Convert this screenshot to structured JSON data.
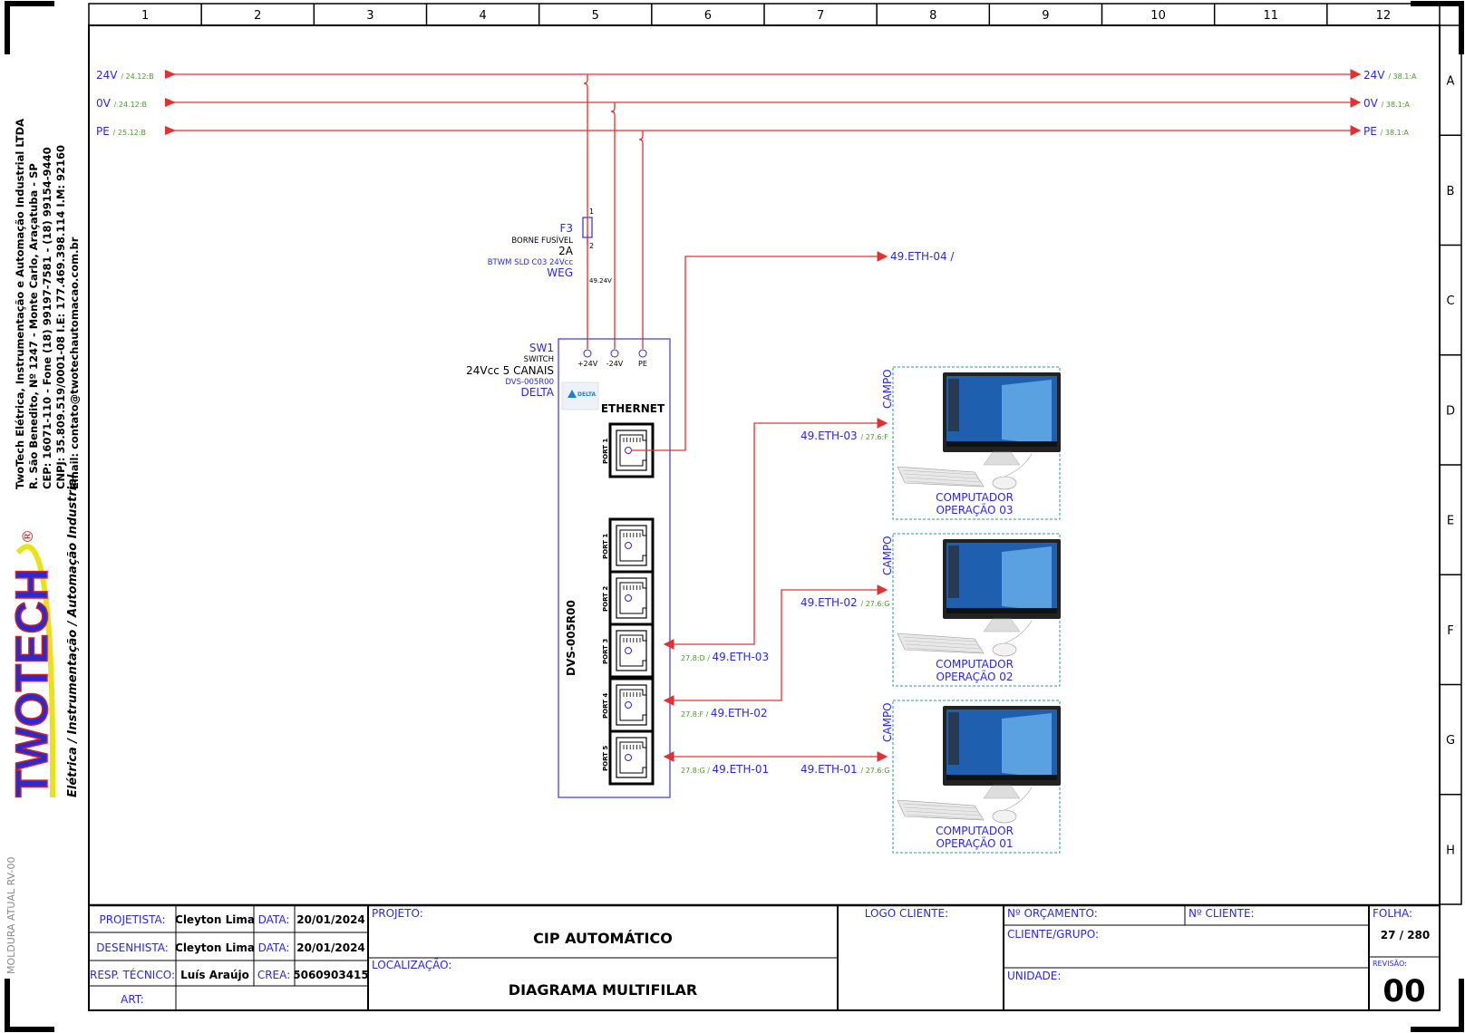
{
  "frame": {
    "columns": [
      "1",
      "2",
      "3",
      "4",
      "5",
      "6",
      "7",
      "8",
      "9",
      "10",
      "11",
      "12"
    ],
    "rows": [
      "A",
      "B",
      "C",
      "D",
      "E",
      "F",
      "G",
      "H"
    ],
    "side_label": "MOLDURA ATUAL RV-00"
  },
  "company": {
    "line1": "TwoTech Elétrica, Instrumentação e Automação Industrial LTDA",
    "line2": "R. São Benedito, Nº 1247 - Monte Carlo, Araçatuba - SP",
    "line3": "CEP: 16071-110 - Fone (18) 99197-7581 - (18) 99154-9440",
    "line4": "CNPJ: 35.809.519/0001-08    I.E: 177.469.398.114  I.M: 92160",
    "line5": "Email: contato@twotechautomacao.com.br",
    "logo_text": "TWOTECH",
    "logo_mark": "®",
    "slogan": "Elétrica / Instrumentação / Automação Industrial"
  },
  "power_rails": [
    {
      "name": "24V",
      "ref_in": "/ 24.12:B",
      "ref_out": "/ 38.1:A"
    },
    {
      "name": "0V",
      "ref_in": "/ 24.12:B",
      "ref_out": "/ 38.1:A"
    },
    {
      "name": "PE",
      "ref_in": "/ 25.12:B",
      "ref_out": "/ 38.1:A"
    }
  ],
  "fuse": {
    "tag": "F3",
    "type": "BORNE FUSÍVEL",
    "rating": "2A",
    "model": "BTWM SLD C03 24Vcc",
    "maker": "WEG",
    "pin1": "1",
    "pin2": "2",
    "wire": "49.24V"
  },
  "switch": {
    "tag": "SW1",
    "type": "SWITCH",
    "spec": "24Vcc 5 CANAIS",
    "model": "DVS-005R00",
    "maker": "DELTA",
    "terminals": [
      "+24V",
      "-24V",
      "PE"
    ],
    "ethernet_label": "ETHERNET",
    "vertical_label": "DVS-005R00",
    "logo": "DELTA",
    "uplink_port": "PORT 1",
    "ports": [
      "PORT 1",
      "PORT 2",
      "PORT 3",
      "PORT 4",
      "PORT 5"
    ]
  },
  "connections": {
    "uplink": "49.ETH-04 /",
    "port3_ref": "27.8:D",
    "port3_wire": "49.ETH-03",
    "port4_ref": "27.8:F",
    "port4_wire": "49.ETH-02",
    "port5_ref": "27.8:G",
    "port5_wire": "49.ETH-01",
    "pc3_wire": "49.ETH-03",
    "pc3_ref": "/ 27.6:F",
    "pc2_wire": "49.ETH-02",
    "pc2_ref": "/ 27.6:G",
    "pc1_wire": "49.ETH-01",
    "pc1_ref": "/ 27.6:G"
  },
  "computers": [
    {
      "field": "CAMPO",
      "line1": "COMPUTADOR",
      "line2": "OPERAÇÃO 03"
    },
    {
      "field": "CAMPO",
      "line1": "COMPUTADOR",
      "line2": "OPERAÇÃO 02"
    },
    {
      "field": "CAMPO",
      "line1": "COMPUTADOR",
      "line2": "OPERAÇÃO 01"
    }
  ],
  "title_block": {
    "projetista_label": "PROJETISTA:",
    "projetista": "Cleyton Lima",
    "desenhista_label": "DESENHISTA:",
    "desenhista": "Cleyton Lima",
    "resp_label": "RESP. TÉCNICO:",
    "resp": "Luís Araújo",
    "art_label": "ART:",
    "data_label": "DATA:",
    "data1": "20/01/2024",
    "data2": "20/01/2024",
    "crea_label": "CREA:",
    "crea": "5060903415",
    "projeto_label": "PROJETO:",
    "projeto": "CIP AUTOMÁTICO",
    "localizacao_label": "LOCALIZAÇÃO:",
    "localizacao": "DIAGRAMA MULTIFILAR",
    "logo_cliente_label": "LOGO CLIENTE:",
    "orcamento_label": "Nº ORÇAMENTO:",
    "cliente_num_label": "Nº CLIENTE:",
    "cliente_grupo_label": "CLIENTE/GRUPO:",
    "unidade_label": "UNIDADE:",
    "folha_label": "FOLHA:",
    "folha": "27 / 280",
    "revisao_label": "REVISÃO:",
    "revisao": "00"
  },
  "colors": {
    "wire": "#e53030",
    "text_blue": "#2b2bd6",
    "ref_green": "#4b9a2e",
    "frame": "#000000",
    "switch_border": "#3a3acf",
    "computer_border": "#2a9a9a"
  }
}
